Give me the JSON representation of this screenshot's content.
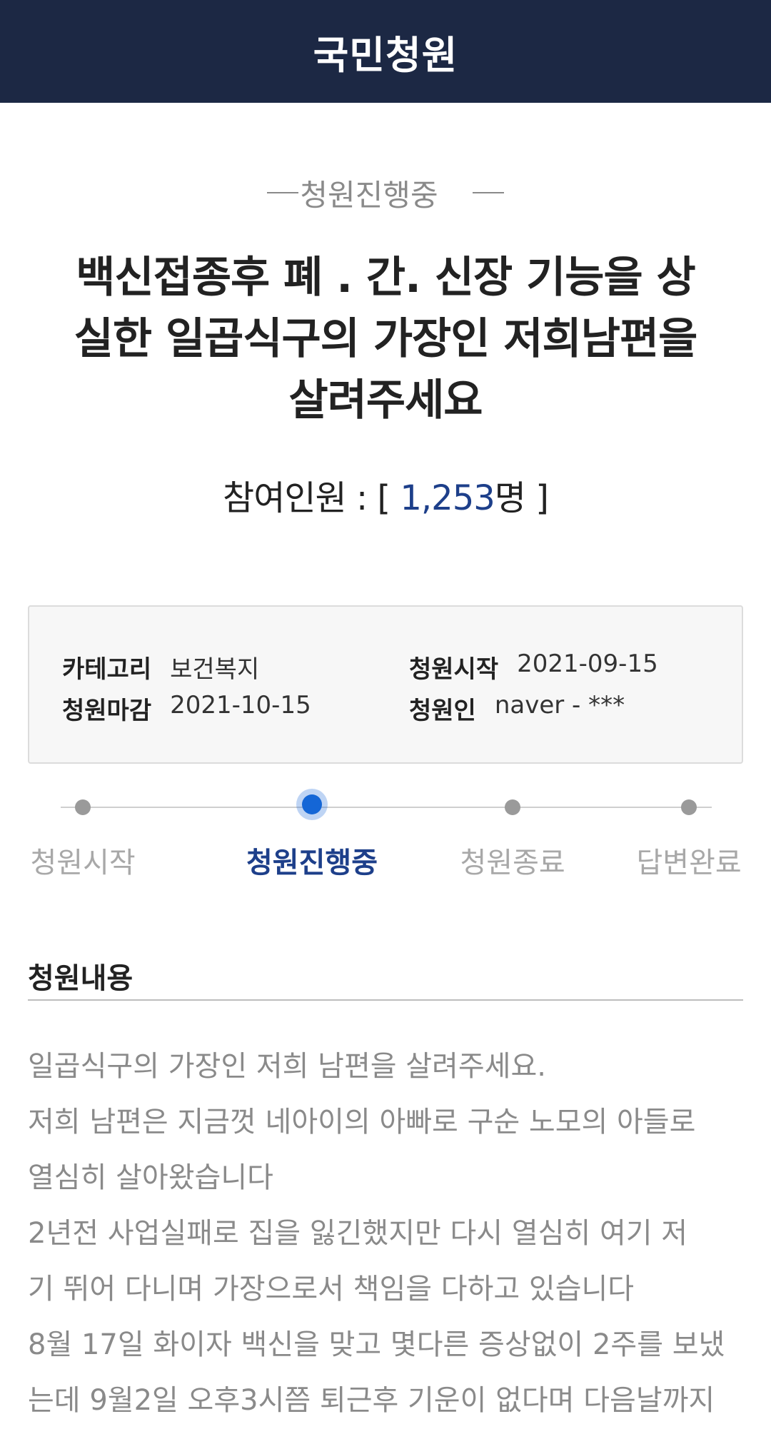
{
  "header": {
    "title": "국민청원"
  },
  "status": {
    "text": "청원진행중"
  },
  "petition": {
    "title": "백신접종후 폐 . 간. 신장 기능을 상실한 일곱식구의 가장인 저희남편을 살려주세요",
    "participants_label": "참여인원 : [ ",
    "participants_count": "1,253",
    "participants_unit": "명 ]"
  },
  "info": {
    "category_label": "카테고리",
    "category_value": "보건복지",
    "start_label": "청원시작",
    "start_value": "2021-09-15",
    "end_label": "청원마감",
    "end_value": "2021-10-15",
    "author_label": "청원인",
    "author_value": "naver - ***"
  },
  "progress": {
    "steps": [
      "청원시작",
      "청원진행중",
      "청원종료",
      "답변완료"
    ],
    "active_index": 1
  },
  "content": {
    "section_title": "청원내용",
    "lines": [
      "일곱식구의 가장인 저희 남편을 살려주세요.",
      "저희 남편은  지금껏 네아이의 아빠로 구순 노모의 아들로",
      "열심히 살아왔습니다",
      "2년전 사업실패로 집을 잃긴했지만  다시 열심히 여기 저",
      "기 뛰어 다니며 가장으로서 책임을 다하고 있습니다",
      "8월 17일 화이자 백신을 맞고 몇다른 증상없이 2주를 보냈",
      "는데 9월2일 오후3시쯤 퇴근후 기운이 없다며 다음날까지"
    ]
  }
}
